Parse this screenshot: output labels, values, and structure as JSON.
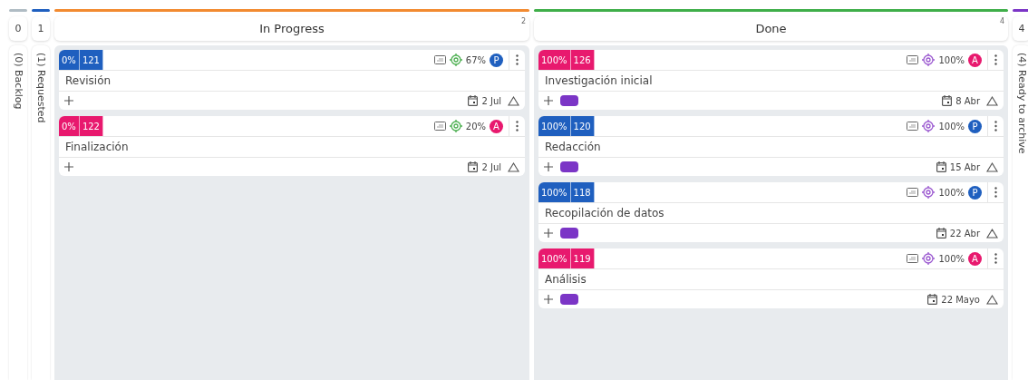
{
  "columns": [
    {
      "kind": "collapsed",
      "number": "0",
      "label": "(0) Backlog",
      "color": "#b0bcc4"
    },
    {
      "kind": "collapsed",
      "number": "1",
      "label": "(1) Requested",
      "color": "#1f5fbf"
    },
    {
      "kind": "expanded",
      "title": "In Progress",
      "count": "2",
      "color": "#f28a30",
      "cards": [
        {
          "percent": "0%",
          "id": "121",
          "color": "#1f5fbf",
          "goal": {
            "value": "67%",
            "color": "#4caf50"
          },
          "avatar": {
            "letter": "P",
            "color": "#1f5fbf"
          },
          "title": "Revisión",
          "date": "2 Jul"
        },
        {
          "percent": "0%",
          "id": "122",
          "color": "#e8196e",
          "goal": {
            "value": "20%",
            "color": "#4caf50"
          },
          "avatar": {
            "letter": "A",
            "color": "#e8196e"
          },
          "title": "Finalización",
          "date": "2 Jul"
        }
      ]
    },
    {
      "kind": "expanded",
      "title": "Done",
      "count": "4",
      "color": "#3fae49",
      "cards": [
        {
          "percent": "100%",
          "id": "126",
          "color": "#e8196e",
          "goal": {
            "value": "100%",
            "color": "#9b59d0"
          },
          "avatar": {
            "letter": "A",
            "color": "#e8196e"
          },
          "title": "Investigación inicial",
          "tag": {
            "color": "#7b35c6"
          },
          "date": "8 Abr"
        },
        {
          "percent": "100%",
          "id": "120",
          "color": "#1f5fbf",
          "goal": {
            "value": "100%",
            "color": "#9b59d0"
          },
          "avatar": {
            "letter": "P",
            "color": "#1f5fbf"
          },
          "title": "Redacción",
          "tag": {
            "color": "#7b35c6"
          },
          "date": "15 Abr"
        },
        {
          "percent": "100%",
          "id": "118",
          "color": "#1f5fbf",
          "goal": {
            "value": "100%",
            "color": "#9b59d0"
          },
          "avatar": {
            "letter": "P",
            "color": "#1f5fbf"
          },
          "title": "Recopilación de datos",
          "tag": {
            "color": "#7b35c6"
          },
          "date": "22 Abr"
        },
        {
          "percent": "100%",
          "id": "119",
          "color": "#e8196e",
          "goal": {
            "value": "100%",
            "color": "#9b59d0"
          },
          "avatar": {
            "letter": "A",
            "color": "#e8196e"
          },
          "title": "Análisis",
          "tag": {
            "color": "#7b35c6"
          },
          "date": "22 Mayo"
        }
      ]
    },
    {
      "kind": "collapsed",
      "number": "4",
      "label": "(4) Ready to archive",
      "color": "#7b35c6"
    }
  ]
}
